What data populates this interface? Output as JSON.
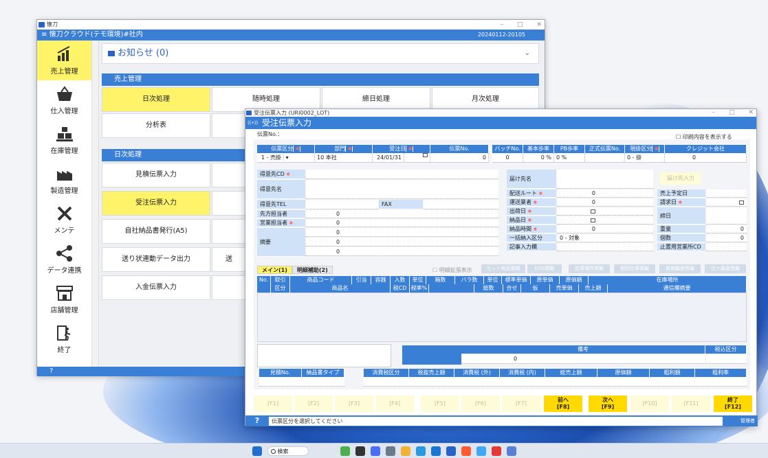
{
  "colors": {
    "accent": "#3a7fd6",
    "highlight": "#fff36a",
    "fkey_active": "#ffd900",
    "label_bg": "#cfe2f8"
  },
  "taskbar": {
    "search": "検索"
  },
  "main": {
    "title": "懐刀",
    "app_title": "懐刀クラウド(テモ環境)#社内",
    "version": "20240112-20105",
    "nav": [
      {
        "label": "売上管理",
        "icon": "bar-chart-icon"
      },
      {
        "label": "仕入管理",
        "icon": "basket-icon"
      },
      {
        "label": "在庫管理",
        "icon": "warehouse-icon"
      },
      {
        "label": "製造管理",
        "icon": "factory-icon"
      },
      {
        "label": "メンテ",
        "icon": "tools-icon"
      },
      {
        "label": "データ連携",
        "icon": "share-icon"
      },
      {
        "label": "店舗管理",
        "icon": "store-icon"
      },
      {
        "label": "終了",
        "icon": "exit-icon"
      }
    ],
    "notice": "お知らせ (0)",
    "sales_section": "売上管理",
    "sales_items": [
      "日次処理",
      "随時処理",
      "締日処理",
      "月次処理",
      "分析表"
    ],
    "daily_section": "日次処理",
    "daily_items": [
      "見積伝票入力",
      "受注伝票入力",
      "自社納品書発行(A5)",
      "送り状連動データ出力",
      "入金伝票入力"
    ],
    "daily_partial": "送",
    "status": "?"
  },
  "dialog": {
    "title": "受注伝票入力 (URI0002_LOT)",
    "heading": "受注伝票入力",
    "slip_no_label": "伝票No.：",
    "print_check": "印刷内容を表示する",
    "header_cols": [
      "伝票区分",
      "部門",
      "受注日",
      "伝票No."
    ],
    "header_vals": [
      "1 - 売掛",
      "10 本社",
      "24/01/31",
      "0"
    ],
    "header2_cols": [
      "バッチNo.",
      "基本歩率",
      "PB歩率",
      "正式伝票No.",
      "現掛区分",
      "クレジット会社"
    ],
    "header2_vals": [
      "0",
      "0 %",
      "0 %",
      "",
      "0 - 掛",
      "0"
    ],
    "left_labels": [
      "得意先CD",
      "得意先名",
      "得意先TEL",
      "先方担当者",
      "営業担当者",
      "摘要"
    ],
    "fax_label": "FAX",
    "left_nums": [
      "0",
      "0",
      "0",
      "0",
      "0"
    ],
    "right_labels": [
      "届け先名",
      "配送ルート",
      "運送業者",
      "出荷日",
      "納品日",
      "納品時間",
      "一括納入区分",
      "記事入力欄"
    ],
    "right_nums": [
      "0",
      "0",
      "0"
    ],
    "bulk_value": "0 - 対象",
    "delivery_btn": "届け先入力",
    "far_labels": [
      "売上予定日",
      "請求日",
      "締日",
      "重量",
      "個数",
      "止置用営業所CD"
    ],
    "far_nums": [
      "0",
      "0"
    ],
    "tabs": [
      "メイン(1)",
      "明細補助(2)"
    ],
    "expand_label": "明細拡張表示",
    "tool_buttons": [
      "セット商品展開",
      "EOS情報",
      "在庫場所情報",
      "個別在庫情報",
      "単価履歴情報",
      "仕入履歴情報"
    ],
    "grid_row1": [
      "No.",
      "取引",
      "商品コード",
      "引当",
      "容器",
      "入数",
      "単位",
      "箱数",
      "バラ数",
      "単位",
      "標準単価",
      "原単価",
      "原価額",
      "在庫場所"
    ],
    "grid_row2": [
      "",
      "区分",
      "商品名",
      "",
      "税CD",
      "税率%",
      "",
      "",
      "総数",
      "合せ",
      "仮",
      "売単価",
      "売上額",
      "通信欄摘要"
    ],
    "remarks_label": "備考",
    "tax_in_label": "税込区分",
    "remarks_value": "0",
    "bottom_left_cols": [
      "見積No.",
      "納品書タイプ"
    ],
    "bottom_cols": [
      "消費税区分",
      "税抜売上額",
      "消費税 (外)",
      "消費税 (内)",
      "総売上額",
      "原価額",
      "粗利額",
      "粗利率"
    ],
    "fkeys": [
      "[F1]",
      "[F2]",
      "[F3]",
      "[F4]",
      "[F5]",
      "[F6]",
      "[F7]",
      "前へ",
      "次へ",
      "[F10]",
      "[F11]",
      "終了"
    ],
    "fkeys_sub": {
      "8": "[F8]",
      "9": "[F9]",
      "12": "[F12]"
    },
    "status_q": "?",
    "status_msg": "伝票区分を選択してください",
    "user": "管理者"
  }
}
